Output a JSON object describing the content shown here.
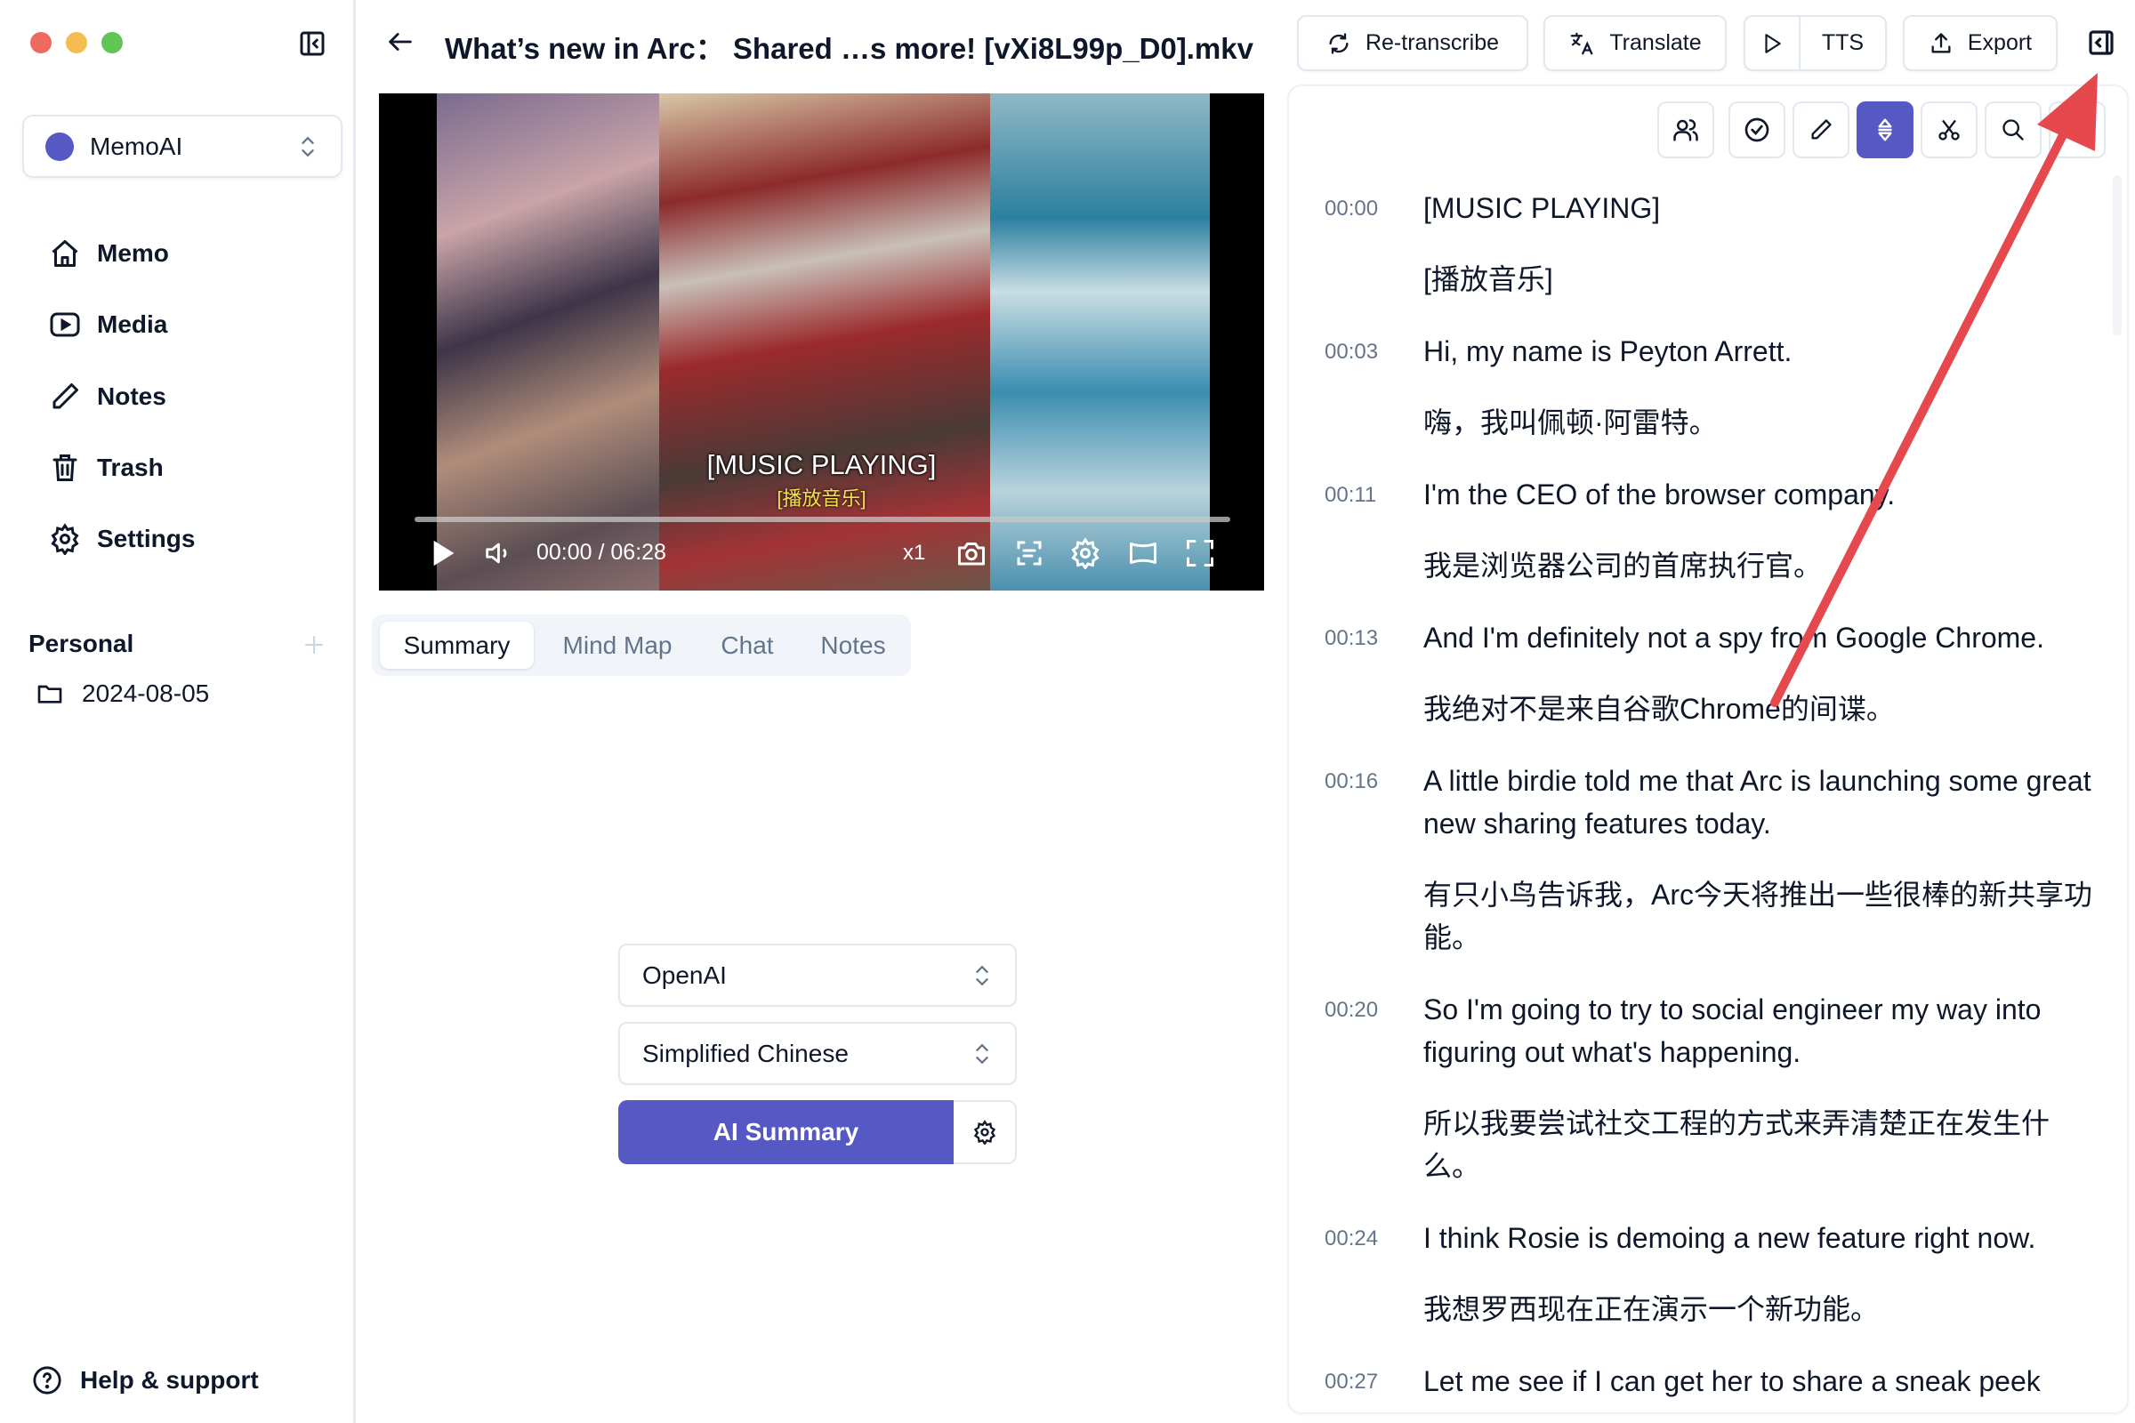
{
  "window": {
    "traffic_lights": {
      "close": "#ee6a5f",
      "minimize": "#f5bd4f",
      "maximize": "#61c554"
    }
  },
  "sidebar": {
    "workspace": {
      "name": "MemoAI",
      "color": "#5659c4"
    },
    "nav": [
      {
        "label": "Memo",
        "icon": "home-icon"
      },
      {
        "label": "Media",
        "icon": "play-square-icon"
      },
      {
        "label": "Notes",
        "icon": "pencil-icon"
      },
      {
        "label": "Trash",
        "icon": "trash-icon"
      },
      {
        "label": "Settings",
        "icon": "gear-icon"
      }
    ],
    "section": {
      "title": "Personal",
      "add_icon": "plus-icon"
    },
    "folders": [
      {
        "label": "2024-08-05",
        "icon": "folder-icon"
      }
    ],
    "help": {
      "label": "Help & support",
      "icon": "help-circle-icon"
    }
  },
  "header": {
    "title": "What’s new in Arc：  Shared …s more! [vXi8L99p_D0].mkv",
    "buttons": {
      "retranscribe": "Re-transcribe",
      "translate": "Translate",
      "tts": "TTS",
      "export": "Export"
    }
  },
  "player": {
    "subtitle_en": "[MUSIC PLAYING]",
    "subtitle_zh": "[播放音乐]",
    "time": "00:00 / 06:28",
    "progress": 0.0,
    "speed": "x1"
  },
  "tabs": [
    {
      "label": "Summary",
      "active": true
    },
    {
      "label": "Mind Map",
      "active": false
    },
    {
      "label": "Chat",
      "active": false
    },
    {
      "label": "Notes",
      "active": false
    }
  ],
  "summary": {
    "provider": "OpenAI",
    "language": "Simplified Chinese",
    "button": "AI Summary"
  },
  "accent": "#5659c4",
  "transcript": [
    {
      "time": "00:00",
      "en": "[MUSIC PLAYING]",
      "zh": "[播放音乐]"
    },
    {
      "time": "00:03",
      "en": "Hi, my name is Peyton Arrett.",
      "zh": "嗨，我叫佩顿·阿雷特。"
    },
    {
      "time": "00:11",
      "en": "I'm the CEO of the browser company.",
      "zh": "我是浏览器公司的首席执行官。"
    },
    {
      "time": "00:13",
      "en": "And I'm definitely not a spy from Google Chrome.",
      "zh": "我绝对不是来自谷歌Chrome的间谍。"
    },
    {
      "time": "00:16",
      "en": "A little birdie told me that Arc is launching some great new sharing features today.",
      "zh": "有只小鸟告诉我，Arc今天将推出一些很棒的新共享功能。"
    },
    {
      "time": "00:20",
      "en": "So I'm going to try to social engineer my way into figuring out what's happening.",
      "zh": "所以我要尝试社交工程的方式来弄清楚正在发生什么。"
    },
    {
      "time": "00:24",
      "en": "I think Rosie is demoing a new feature right now.",
      "zh": "我想罗西现在正在演示一个新功能。"
    },
    {
      "time": "00:27",
      "en": "Let me see if I can get her to share a sneak peek",
      "zh": ""
    }
  ]
}
